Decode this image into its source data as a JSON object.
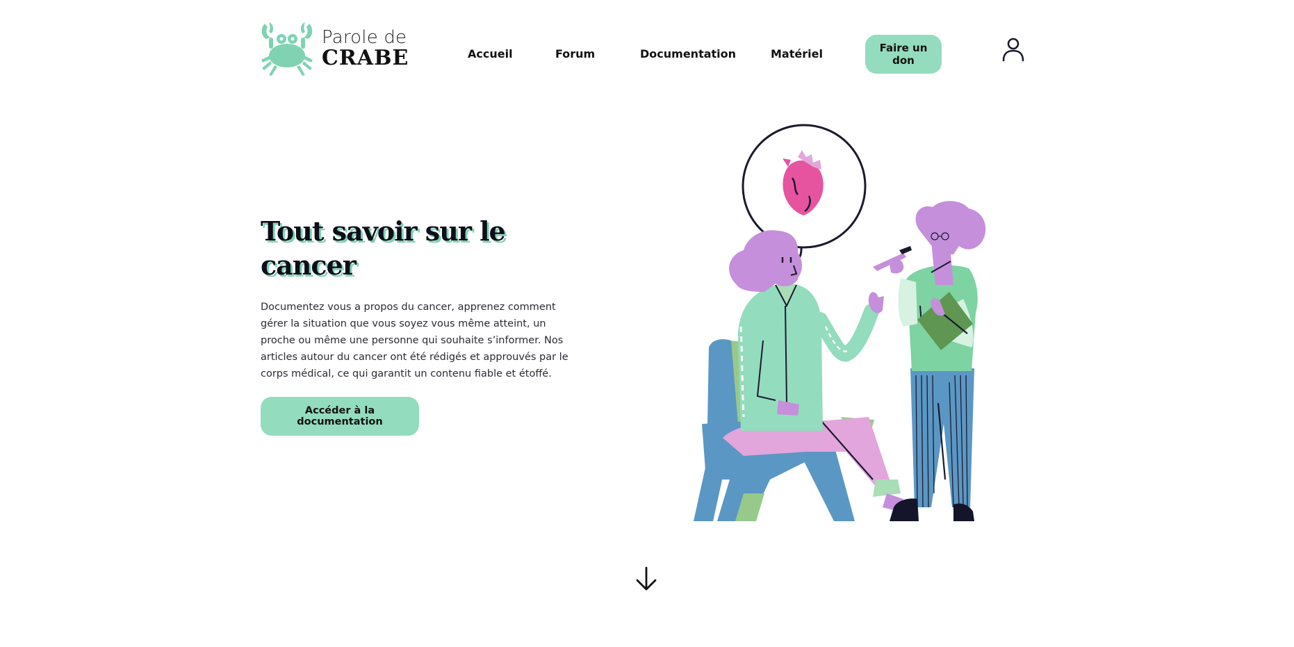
{
  "brand": {
    "name_line1": "Parole de",
    "name_line2": "CRABE",
    "logo_icon": "crab-icon",
    "color": "#7fd3b3"
  },
  "nav": {
    "items": [
      {
        "label": "Accueil"
      },
      {
        "label": "Forum"
      },
      {
        "label": "Documentation"
      },
      {
        "label": "Matériel"
      }
    ],
    "donate_label": "Faire un don",
    "user_icon": "user-icon"
  },
  "hero": {
    "title": "Tout savoir sur le cancer",
    "description": "Documentez vous a propos du cancer, apprenez comment gérer la situation que vous soyez vous même atteint, un proche ou même une personne qui souhaite s’informer. Nos articles autour du cancer ont été rédigés et approuvés par le corps médical, ce qui garantit un contenu fiable et étoffé.",
    "cta_label": "Accéder à la documentation",
    "illustration": "patient-doctor-consultation-illustration",
    "scroll_icon": "arrow-down-icon"
  },
  "colors": {
    "accent": "#93dcbd",
    "text": "#1a1a2e",
    "title_shadow": "#7fd3b3",
    "purple": "#c58fdb",
    "blue": "#5b97c4",
    "pink": "#e6549f"
  }
}
